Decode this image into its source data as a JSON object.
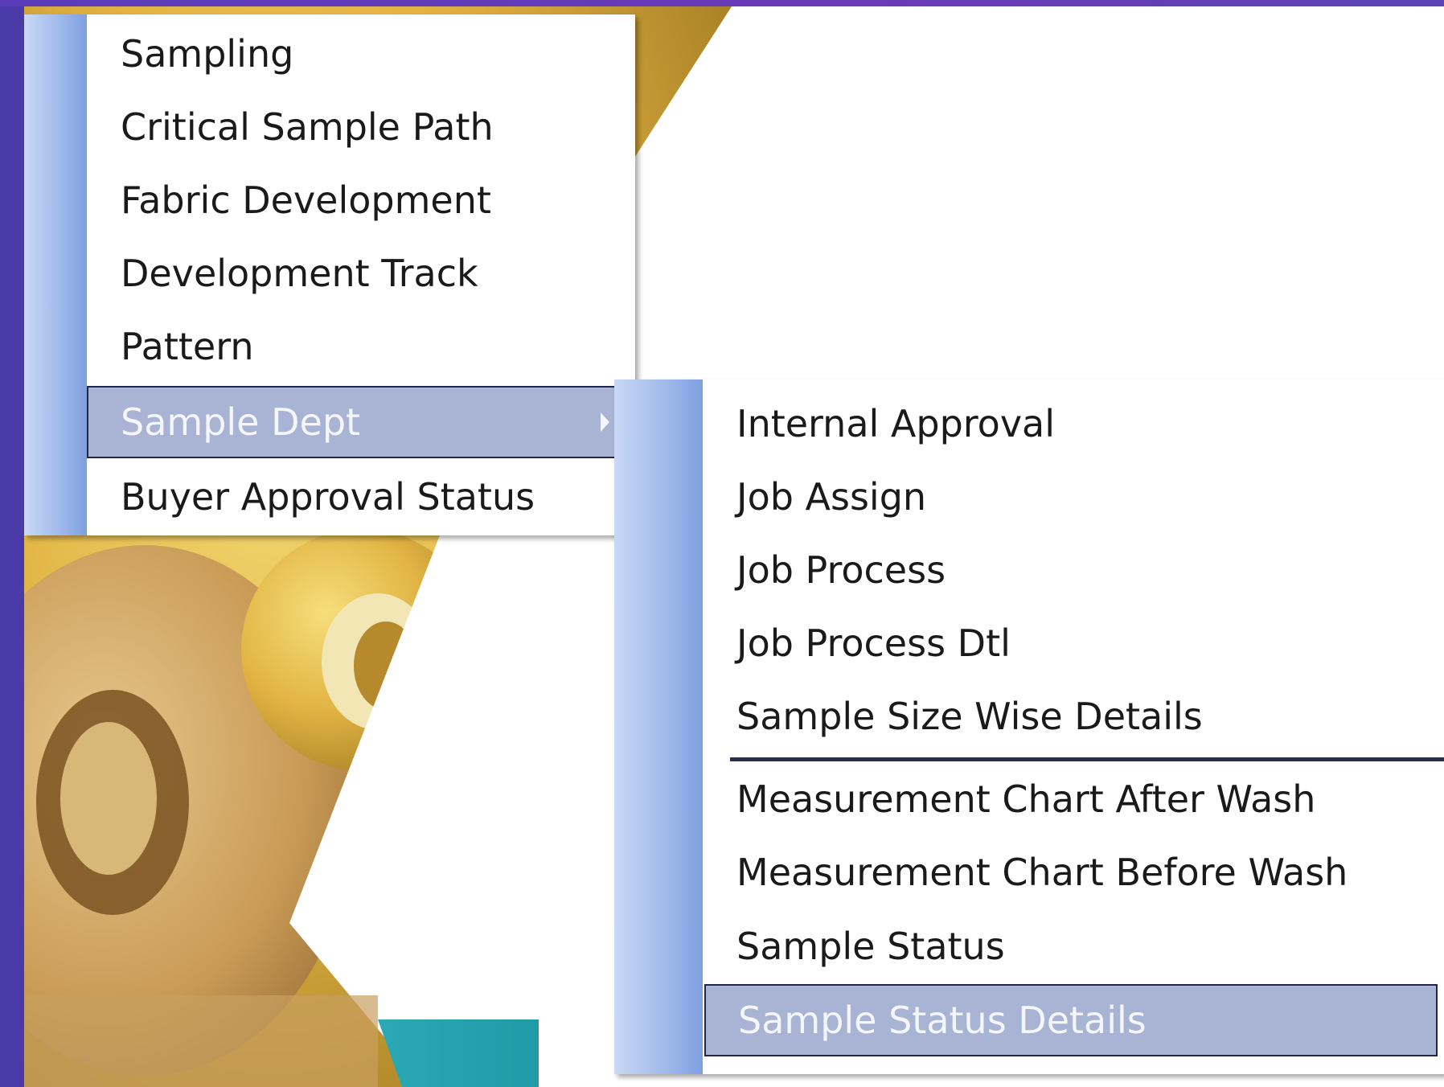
{
  "main_menu": {
    "items": [
      {
        "label": "Sampling"
      },
      {
        "label": "Critical Sample Path"
      },
      {
        "label": "Fabric Development"
      },
      {
        "label": "Development Track"
      },
      {
        "label": "Pattern"
      },
      {
        "label": "Sample Dept",
        "highlighted": true,
        "has_submenu": true
      },
      {
        "label": "Buyer Approval Status"
      }
    ]
  },
  "sample_dept_submenu": {
    "items": [
      {
        "label": "Internal Approval"
      },
      {
        "label": "Job Assign"
      },
      {
        "label": "Job Process"
      },
      {
        "label": "Job Process Dtl"
      },
      {
        "label": "Sample Size Wise Details"
      },
      {
        "label": "Measurement Chart After Wash"
      },
      {
        "label": "Measurement Chart Before Wash"
      },
      {
        "label": "Sample Status"
      },
      {
        "label": "Sample Status Details",
        "highlighted": true
      }
    ]
  },
  "colors": {
    "window_frame": "#4a3aa8",
    "menu_highlight": "#a9b3d4",
    "menu_gutter": "#9fb8ea",
    "teal_band": "#25a7b0"
  }
}
